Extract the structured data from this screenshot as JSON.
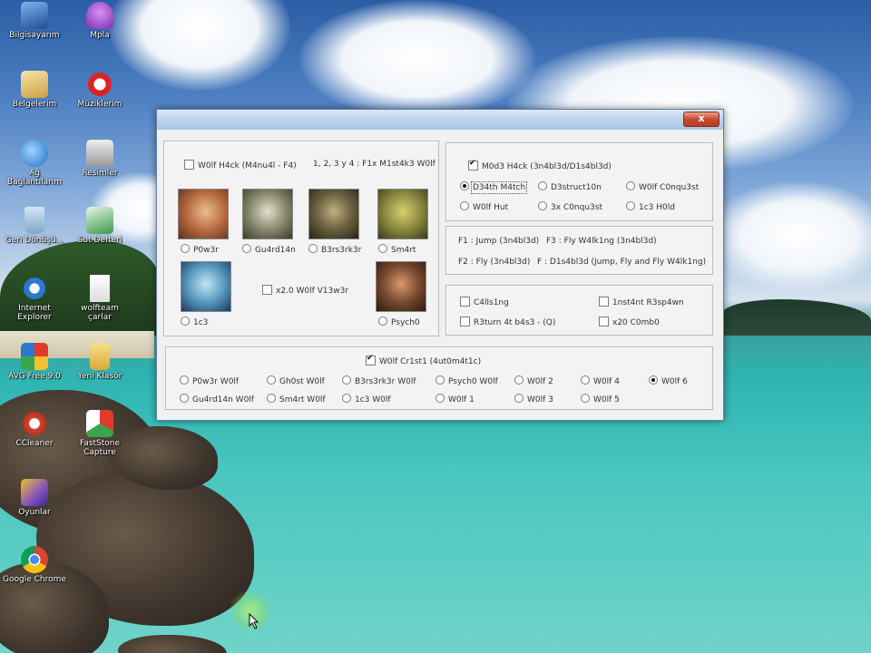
{
  "desktop": {
    "icons": [
      {
        "label": "Bilgisayarım",
        "color": "#3a7bd5"
      },
      {
        "label": "Mpla",
        "color": "#a24bd0"
      },
      {
        "label": "Belgelerim",
        "color": "#e0c060"
      },
      {
        "label": "Müziklerim",
        "color": "#d03030"
      },
      {
        "label": "Ağ Bağlantılarım",
        "color": "#2f8fd8"
      },
      {
        "label": "Resimler",
        "color": "#b0b0b0"
      },
      {
        "label": "Geri Dönüşü...",
        "color": "#a8c8e0"
      },
      {
        "label": "Sut Defteri",
        "color": "#3aa64a"
      },
      {
        "label": "Internet Explorer",
        "color": "#2a78d0"
      },
      {
        "label": "wolfteam çarlar",
        "color": "#f4f4f4"
      },
      {
        "label": "AVG Free 9.0",
        "color": "#d8a030"
      },
      {
        "label": "Yeni Klasör",
        "color": "#e6c04c"
      },
      {
        "label": "CCleaner",
        "color": "#d04030"
      },
      {
        "label": "FastStone Capture",
        "color": "#d0d0d0"
      },
      {
        "label": "Oyunlar",
        "color": "#8050c0"
      },
      {
        "label": "Google Chrome",
        "color": "#d94436"
      }
    ]
  },
  "window": {
    "close_label": "x",
    "wolf_hack": {
      "checkbox_label": "W0lf H4ck (M4nu4l - F4)",
      "hint": "1, 2, 3 y 4 : F1x M1st4k3 W0lf",
      "portraits": [
        {
          "label": "P0w3r",
          "selected": false,
          "color": "#b86a40"
        },
        {
          "label": "Gu4rd14n",
          "selected": false,
          "color": "#8a8a70"
        },
        {
          "label": "B3rs3rk3r",
          "selected": false,
          "color": "#6a6040"
        },
        {
          "label": "Sm4rt",
          "selected": false,
          "color": "#8a8a40"
        },
        {
          "label": "1c3",
          "selected": false,
          "color": "#5a9ac0"
        },
        {
          "label": "Psych0",
          "selected": false,
          "color": "#7a4a30"
        }
      ],
      "view_label": "x2.0 W0lf V13w3r"
    },
    "mode_hack": {
      "checkbox_label": "M0d3 H4ck (3n4bl3d/D1s4bl3d)",
      "checked": true,
      "modes": [
        {
          "label": "D34th M4tch",
          "selected": true
        },
        {
          "label": "D3struct10n",
          "selected": false
        },
        {
          "label": "W0lf C0nqu3st",
          "selected": false
        },
        {
          "label": "W0lf Hut",
          "selected": false
        },
        {
          "label": "3x C0nqu3st",
          "selected": false
        },
        {
          "label": "1c3 H0ld",
          "selected": false
        }
      ]
    },
    "keys": {
      "line1_a": "F1 : Jump (3n4bl3d)",
      "line1_b": "F3 : Fly W4lk1ng (3n4bl3d)",
      "line2_a": "F2 : Fly (3n4bl3d)",
      "line2_b": "F : D1s4bl3d (Jump, Fly and Fly W4lk1ng)"
    },
    "extras": [
      {
        "label": "C4lls1ng"
      },
      {
        "label": "1nst4nt R3sp4wn"
      },
      {
        "label": "R3turn 4t b4s3 - (Q)"
      },
      {
        "label": "x20 C0mb0"
      }
    ],
    "wolf_critical": {
      "checkbox_label": "W0lf Cr1st1 (4ut0m4t1c)",
      "checked": true,
      "options": [
        {
          "label": "P0w3r W0lf",
          "selected": false
        },
        {
          "label": "Gh0st W0lf",
          "selected": false
        },
        {
          "label": "B3rs3rk3r W0lf",
          "selected": false
        },
        {
          "label": "Psych0 W0lf",
          "selected": false
        },
        {
          "label": "W0lf 2",
          "selected": false
        },
        {
          "label": "W0lf 4",
          "selected": false
        },
        {
          "label": "W0lf 6",
          "selected": true
        },
        {
          "label": "Gu4rd14n W0lf",
          "selected": false
        },
        {
          "label": "Sm4rt W0lf",
          "selected": false
        },
        {
          "label": "1c3 W0lf",
          "selected": false
        },
        {
          "label": "W0lf 1",
          "selected": false
        },
        {
          "label": "W0lf 3",
          "selected": false
        },
        {
          "label": "W0lf 5",
          "selected": false
        }
      ]
    }
  }
}
